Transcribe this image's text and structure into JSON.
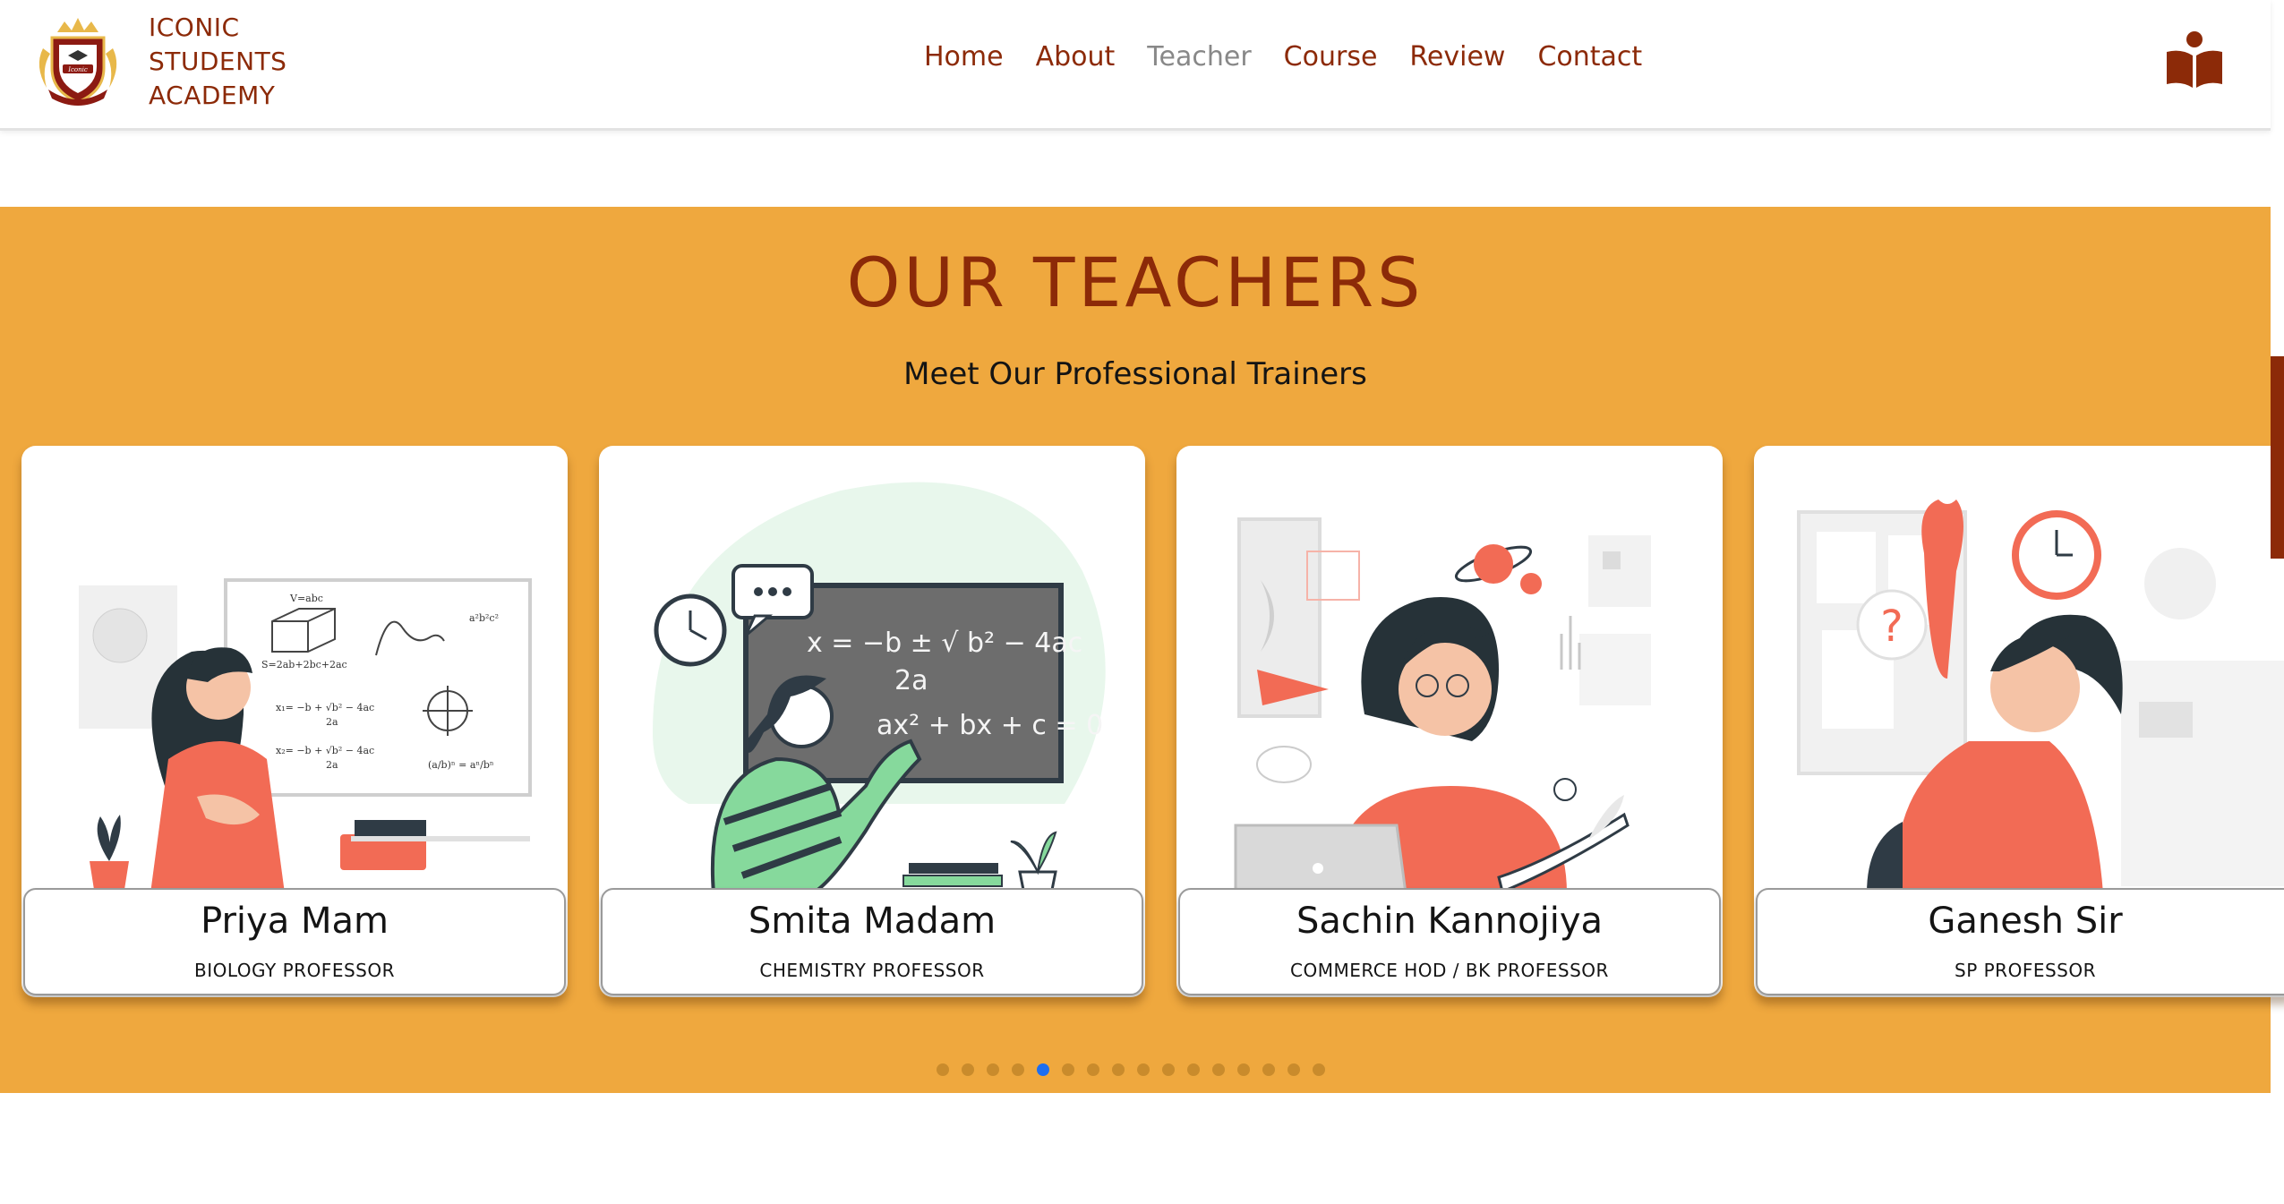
{
  "brand": {
    "line1": "ICONIC",
    "line2": "STUDENTS",
    "line3": "ACADEMY",
    "logo_icon": "academy-crest-logo"
  },
  "nav": {
    "items": [
      "Home",
      "About",
      "Teacher",
      "Course",
      "Review",
      "Contact"
    ],
    "active": "Teacher"
  },
  "header_icon": "book-reader-icon",
  "section": {
    "title": "OUR TEACHERS",
    "subtitle": "Meet Our Professional Trainers"
  },
  "teachers": [
    {
      "name": "Priya Mam",
      "role": "BIOLOGY PROFESSOR"
    },
    {
      "name": "Smita Madam",
      "role": "CHEMISTRY PROFESSOR"
    },
    {
      "name": "Sachin Kannojiya",
      "role": "COMMERCE HOD / BK PROFESSOR"
    },
    {
      "name": "Ganesh Sir",
      "role": "SP PROFESSOR"
    }
  ],
  "carousel": {
    "dot_count": 16,
    "active_index": 4
  },
  "colors": {
    "brand": "#8c2a08",
    "section_bg": "#efa83e",
    "active_dot": "#1d6ef0",
    "nav_active": "#888888"
  }
}
